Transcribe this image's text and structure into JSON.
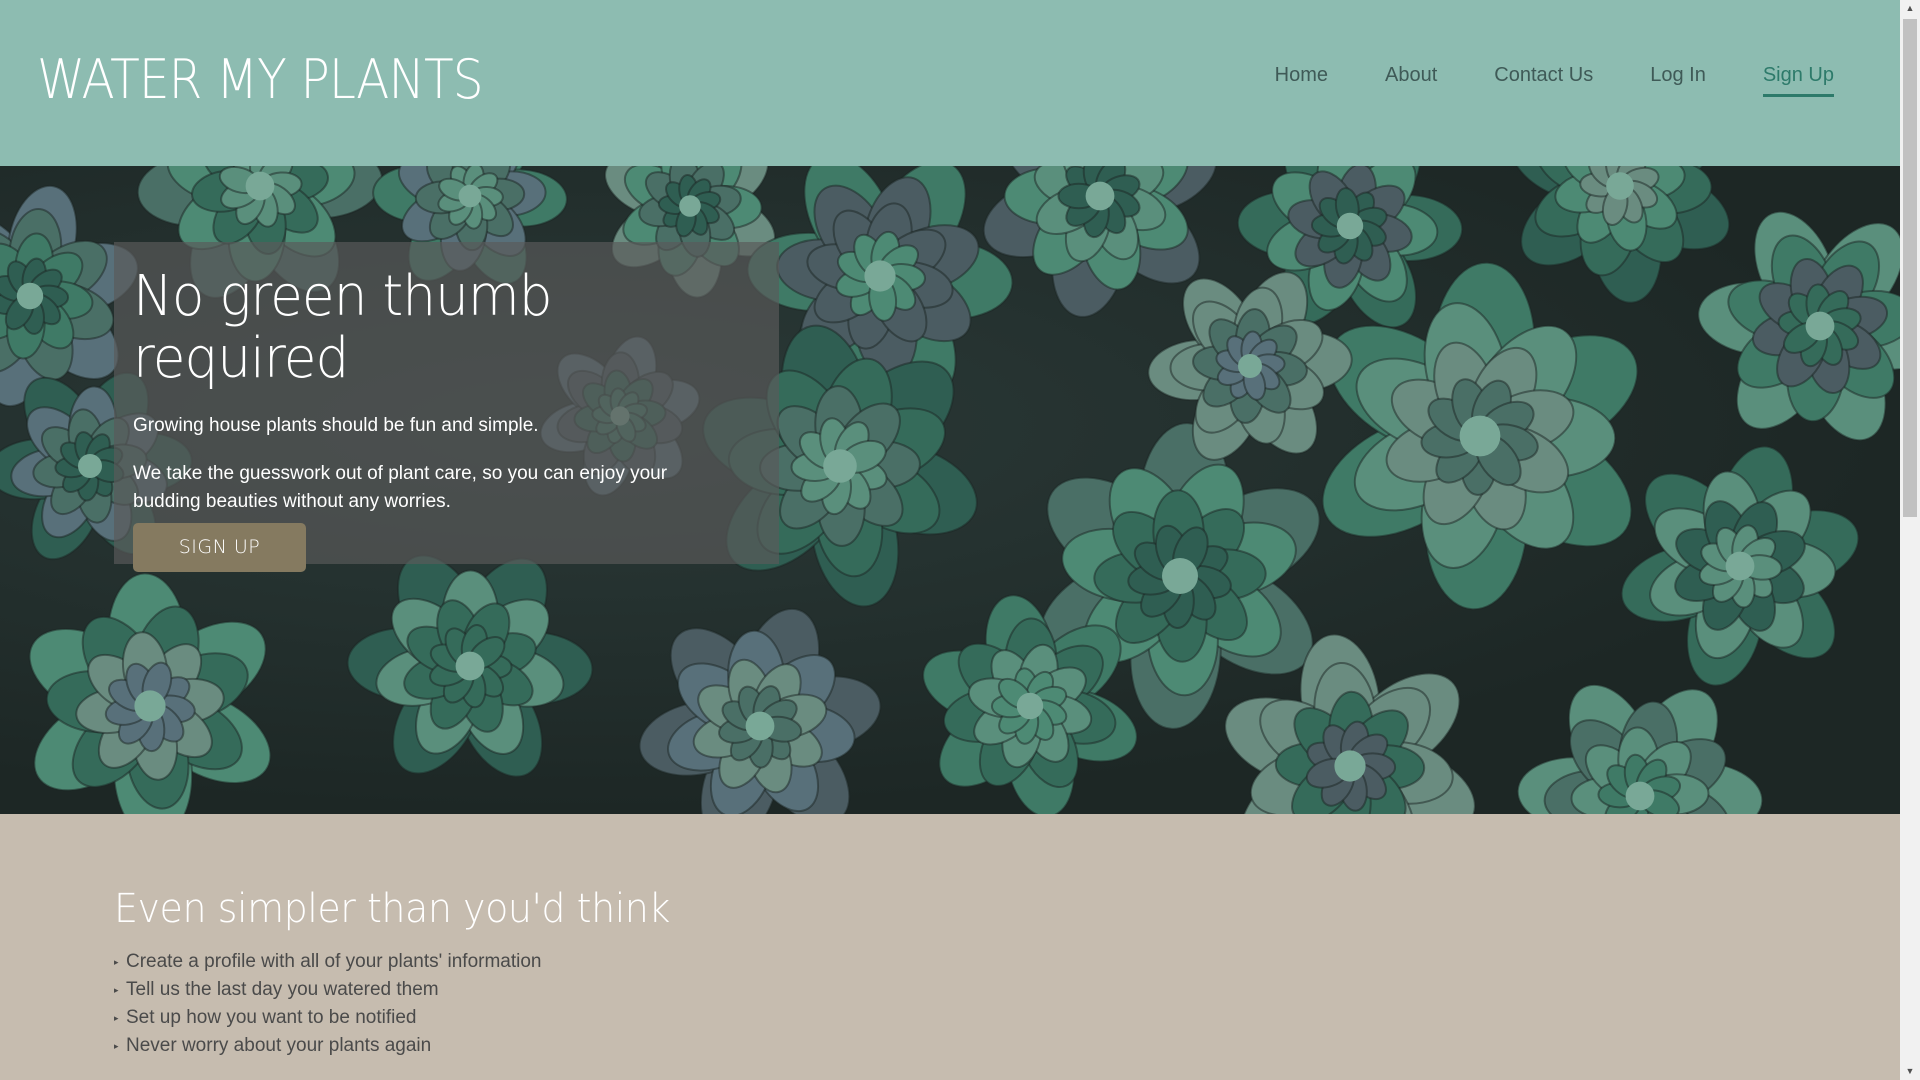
{
  "header": {
    "logo": "WATER MY PLANTS",
    "nav": [
      {
        "label": "Home",
        "active": false
      },
      {
        "label": "About",
        "active": false
      },
      {
        "label": "Contact Us",
        "active": false
      },
      {
        "label": "Log In",
        "active": false
      },
      {
        "label": "Sign Up",
        "active": true
      }
    ]
  },
  "hero": {
    "title": "No green thumb required",
    "paragraph1": "Growing house plants should be fun and simple.",
    "paragraph2": "We take the guesswork out of plant care, so you can enjoy your budding beauties without any worries.",
    "button_label": "SIGN UP"
  },
  "features": {
    "title": "Even simpler than you'd think",
    "items": [
      "Create a profile with all of your plants' information",
      "Tell us the last day you watered them",
      "Set up how you want to be notified",
      "Never worry about your plants again"
    ]
  },
  "colors": {
    "header_bg": "#8dbcb1",
    "nav_active": "#2d7a6a",
    "button_bg": "#857a60",
    "section_bg": "#c6bcaf"
  },
  "icons": {
    "scroll_up": "▲",
    "scroll_down": "▼",
    "bullet": "▸"
  }
}
